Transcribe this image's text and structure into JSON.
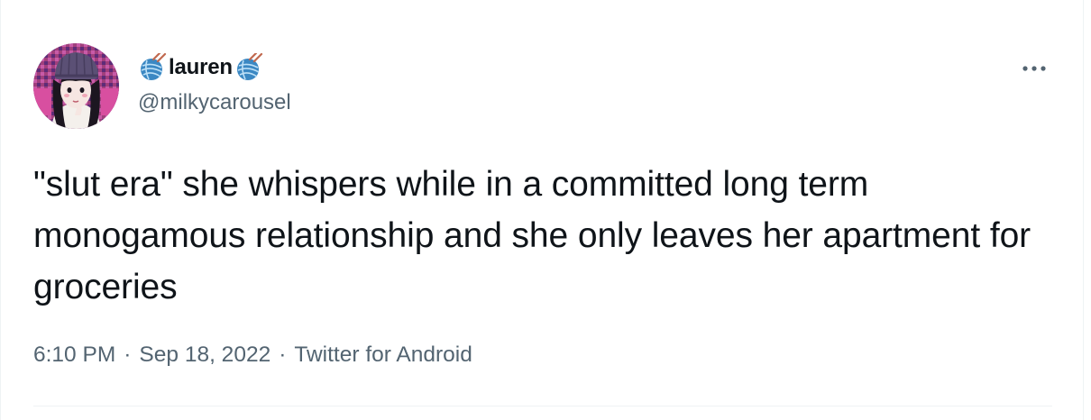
{
  "author": {
    "display_name": "lauren",
    "handle": "@milkycarousel",
    "name_emoji": "yarn-ball-icon",
    "avatar": "profile-avatar-illustration"
  },
  "tweet": {
    "text": "\"slut era\" she whispers while in a committed long term monogamous relationship and she only leaves her apartment for groceries",
    "time": "6:10 PM",
    "date": "Sep 18, 2022",
    "source": "Twitter for Android",
    "separator": "·"
  },
  "icons": {
    "more": "more-options-icon"
  },
  "colors": {
    "text_primary": "#0f1419",
    "text_secondary": "#536471",
    "divider": "#eff3f4",
    "yarn_blue": "#3b88c3"
  }
}
